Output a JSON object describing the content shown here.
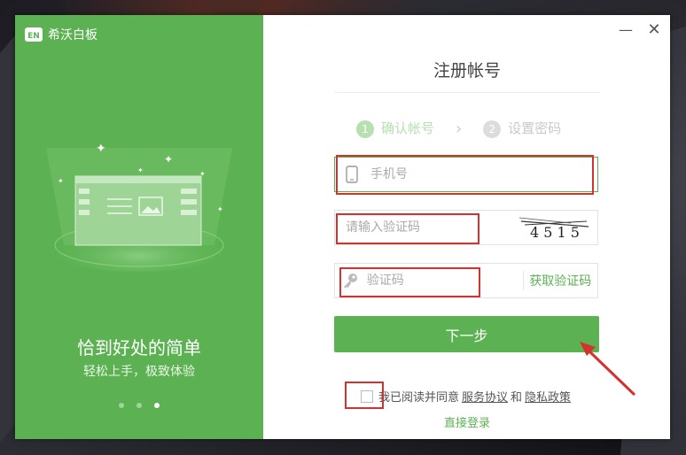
{
  "app": {
    "logo_badge": "EN",
    "name": "希沃白板"
  },
  "promo": {
    "tagline": "恰到好处的简单",
    "subline": "轻松上手，极致体验",
    "carousel_active_index": 2,
    "carousel_count": 3
  },
  "window_controls": {
    "minimize_glyph": "—",
    "close_glyph": "✕"
  },
  "form": {
    "title": "注册帐号",
    "steps": [
      {
        "num": "1",
        "label": "确认帐号"
      },
      {
        "num": "2",
        "label": "设置密码"
      }
    ],
    "step_separator": "›",
    "phone": {
      "placeholder": "手机号",
      "value": ""
    },
    "captcha": {
      "placeholder": "请输入验证码",
      "value": "",
      "image_text": "4 5 1 5"
    },
    "sms": {
      "placeholder": "验证码",
      "value": "",
      "get_code_label": "获取验证码"
    },
    "next_label": "下一步",
    "agreement": {
      "prefix": "我已阅读并同意",
      "terms": "服务协议",
      "and": "和",
      "privacy": "隐私政策",
      "checked": false
    },
    "direct_login_label": "直接登录"
  },
  "colors": {
    "brand": "#5cb252",
    "annotation": "#d3322f"
  },
  "icons": {
    "phone": "phone-icon",
    "key": "key-icon",
    "logo": "logo-icon"
  }
}
